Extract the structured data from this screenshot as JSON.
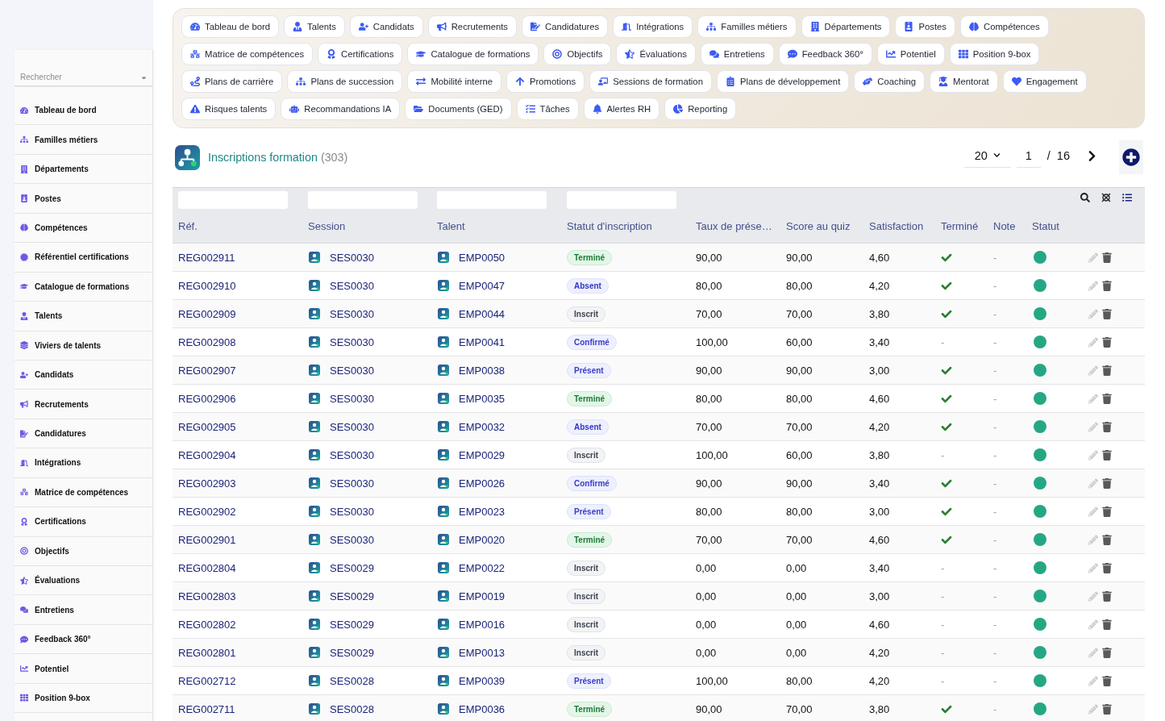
{
  "sidebar": {
    "search": {
      "placeholder": "Rechercher"
    },
    "items": [
      {
        "label": "Tableau de bord"
      },
      {
        "label": "Familles métiers"
      },
      {
        "label": "Départements"
      },
      {
        "label": "Postes"
      },
      {
        "label": "Compétences"
      },
      {
        "label": "Référentiel certifications"
      },
      {
        "label": "Catalogue de formations"
      },
      {
        "label": "Talents"
      },
      {
        "label": "Viviers de talents"
      },
      {
        "label": "Candidats"
      },
      {
        "label": "Recrutements"
      },
      {
        "label": "Candidatures"
      },
      {
        "label": "Intégrations"
      },
      {
        "label": "Matrice de compétences"
      },
      {
        "label": "Certifications"
      },
      {
        "label": "Objectifs"
      },
      {
        "label": "Évaluations"
      },
      {
        "label": "Entretiens"
      },
      {
        "label": "Feedback 360°"
      },
      {
        "label": "Potentiel"
      },
      {
        "label": "Position 9-box"
      }
    ]
  },
  "top_nav": {
    "items": [
      {
        "label": "Tableau de bord"
      },
      {
        "label": "Talents"
      },
      {
        "label": "Candidats"
      },
      {
        "label": "Recrutements"
      },
      {
        "label": "Candidatures"
      },
      {
        "label": "Intégrations"
      },
      {
        "label": "Familles métiers"
      },
      {
        "label": "Départements"
      },
      {
        "label": "Postes"
      },
      {
        "label": "Compétences"
      },
      {
        "label": "Matrice de compétences"
      },
      {
        "label": "Certifications"
      },
      {
        "label": "Catalogue de formations"
      },
      {
        "label": "Objectifs"
      },
      {
        "label": "Évaluations"
      },
      {
        "label": "Entretiens"
      },
      {
        "label": "Feedback 360°"
      },
      {
        "label": "Potentiel"
      },
      {
        "label": "Position 9-box"
      },
      {
        "label": "Plans de carrière"
      },
      {
        "label": "Plans de succession"
      },
      {
        "label": "Mobilité interne"
      },
      {
        "label": "Promotions"
      },
      {
        "label": "Sessions de formation"
      },
      {
        "label": "Plans de développement"
      },
      {
        "label": "Coaching"
      },
      {
        "label": "Mentorat"
      },
      {
        "label": "Engagement"
      },
      {
        "label": "Risques talents"
      },
      {
        "label": "Recommandations IA"
      },
      {
        "label": "Documents (GED)"
      },
      {
        "label": "Tâches"
      },
      {
        "label": "Alertes RH"
      },
      {
        "label": "Reporting"
      }
    ]
  },
  "page": {
    "title": "Inscriptions formation",
    "count": "(303)",
    "per_page": "20",
    "page": "1",
    "separator": "/",
    "page_count": "16"
  },
  "table": {
    "columns": [
      {
        "label": "Réf.",
        "filterable": true
      },
      {
        "label": "Session",
        "filterable": true
      },
      {
        "label": "Talent",
        "filterable": true
      },
      {
        "label": "Statut d'inscription",
        "filterable": true
      },
      {
        "label": "Taux de prése…",
        "filterable": false
      },
      {
        "label": "Score au quiz",
        "filterable": false
      },
      {
        "label": "Satisfaction",
        "filterable": false
      },
      {
        "label": "Terminé",
        "filterable": false
      },
      {
        "label": "Note",
        "filterable": false
      },
      {
        "label": "Statut",
        "filterable": false
      }
    ],
    "rows": [
      {
        "ref": "REG002911",
        "session": "SES0030",
        "talent": "EMP0050",
        "status": {
          "label": "Terminé",
          "kind": "done"
        },
        "attendance": "90,00",
        "quiz": "90,00",
        "satisfaction": "4,60",
        "completed": true,
        "note": "-",
        "active": true
      },
      {
        "ref": "REG002910",
        "session": "SES0030",
        "talent": "EMP0047",
        "status": {
          "label": "Absent",
          "kind": "absent"
        },
        "attendance": "80,00",
        "quiz": "80,00",
        "satisfaction": "4,20",
        "completed": true,
        "note": "-",
        "active": true
      },
      {
        "ref": "REG002909",
        "session": "SES0030",
        "talent": "EMP0044",
        "status": {
          "label": "Inscrit",
          "kind": "registered"
        },
        "attendance": "70,00",
        "quiz": "70,00",
        "satisfaction": "3,80",
        "completed": true,
        "note": "-",
        "active": true
      },
      {
        "ref": "REG002908",
        "session": "SES0030",
        "talent": "EMP0041",
        "status": {
          "label": "Confirmé",
          "kind": "confirmed"
        },
        "attendance": "100,00",
        "quiz": "60,00",
        "satisfaction": "3,40",
        "completed": false,
        "completed_text": "-",
        "note": "-",
        "active": true
      },
      {
        "ref": "REG002907",
        "session": "SES0030",
        "talent": "EMP0038",
        "status": {
          "label": "Présent",
          "kind": "present"
        },
        "attendance": "90,00",
        "quiz": "90,00",
        "satisfaction": "3,00",
        "completed": true,
        "note": "-",
        "active": true
      },
      {
        "ref": "REG002906",
        "session": "SES0030",
        "talent": "EMP0035",
        "status": {
          "label": "Terminé",
          "kind": "done"
        },
        "attendance": "80,00",
        "quiz": "80,00",
        "satisfaction": "4,60",
        "completed": true,
        "note": "-",
        "active": true
      },
      {
        "ref": "REG002905",
        "session": "SES0030",
        "talent": "EMP0032",
        "status": {
          "label": "Absent",
          "kind": "absent"
        },
        "attendance": "70,00",
        "quiz": "70,00",
        "satisfaction": "4,20",
        "completed": true,
        "note": "-",
        "active": true
      },
      {
        "ref": "REG002904",
        "session": "SES0030",
        "talent": "EMP0029",
        "status": {
          "label": "Inscrit",
          "kind": "registered"
        },
        "attendance": "100,00",
        "quiz": "60,00",
        "satisfaction": "3,80",
        "completed": false,
        "completed_text": "-",
        "note": "-",
        "active": true
      },
      {
        "ref": "REG002903",
        "session": "SES0030",
        "talent": "EMP0026",
        "status": {
          "label": "Confirmé",
          "kind": "confirmed"
        },
        "attendance": "90,00",
        "quiz": "90,00",
        "satisfaction": "3,40",
        "completed": true,
        "note": "-",
        "active": true
      },
      {
        "ref": "REG002902",
        "session": "SES0030",
        "talent": "EMP0023",
        "status": {
          "label": "Présent",
          "kind": "present"
        },
        "attendance": "80,00",
        "quiz": "80,00",
        "satisfaction": "3,00",
        "completed": true,
        "note": "-",
        "active": true
      },
      {
        "ref": "REG002901",
        "session": "SES0030",
        "talent": "EMP0020",
        "status": {
          "label": "Terminé",
          "kind": "done"
        },
        "attendance": "70,00",
        "quiz": "70,00",
        "satisfaction": "4,60",
        "completed": true,
        "note": "-",
        "active": true
      },
      {
        "ref": "REG002804",
        "session": "SES0029",
        "talent": "EMP0022",
        "status": {
          "label": "Inscrit",
          "kind": "registered"
        },
        "attendance": "0,00",
        "quiz": "0,00",
        "satisfaction": "3,40",
        "completed": false,
        "completed_text": "-",
        "note": "-",
        "active": true
      },
      {
        "ref": "REG002803",
        "session": "SES0029",
        "talent": "EMP0019",
        "status": {
          "label": "Inscrit",
          "kind": "registered"
        },
        "attendance": "0,00",
        "quiz": "0,00",
        "satisfaction": "3,00",
        "completed": false,
        "completed_text": "-",
        "note": "-",
        "active": true
      },
      {
        "ref": "REG002802",
        "session": "SES0029",
        "talent": "EMP0016",
        "status": {
          "label": "Inscrit",
          "kind": "registered"
        },
        "attendance": "0,00",
        "quiz": "0,00",
        "satisfaction": "4,60",
        "completed": false,
        "completed_text": "-",
        "note": "-",
        "active": true
      },
      {
        "ref": "REG002801",
        "session": "SES0029",
        "talent": "EMP0013",
        "status": {
          "label": "Inscrit",
          "kind": "registered"
        },
        "attendance": "0,00",
        "quiz": "0,00",
        "satisfaction": "4,20",
        "completed": false,
        "completed_text": "-",
        "note": "-",
        "active": true
      },
      {
        "ref": "REG002712",
        "session": "SES0028",
        "talent": "EMP0039",
        "status": {
          "label": "Présent",
          "kind": "present"
        },
        "attendance": "100,00",
        "quiz": "80,00",
        "satisfaction": "4,20",
        "completed": false,
        "completed_text": "-",
        "note": "-",
        "active": true
      },
      {
        "ref": "REG002711",
        "session": "SES0028",
        "talent": "EMP0036",
        "status": {
          "label": "Terminé",
          "kind": "done"
        },
        "attendance": "90,00",
        "quiz": "70,00",
        "satisfaction": "3,80",
        "completed": true,
        "note": "-",
        "active": true
      }
    ]
  }
}
